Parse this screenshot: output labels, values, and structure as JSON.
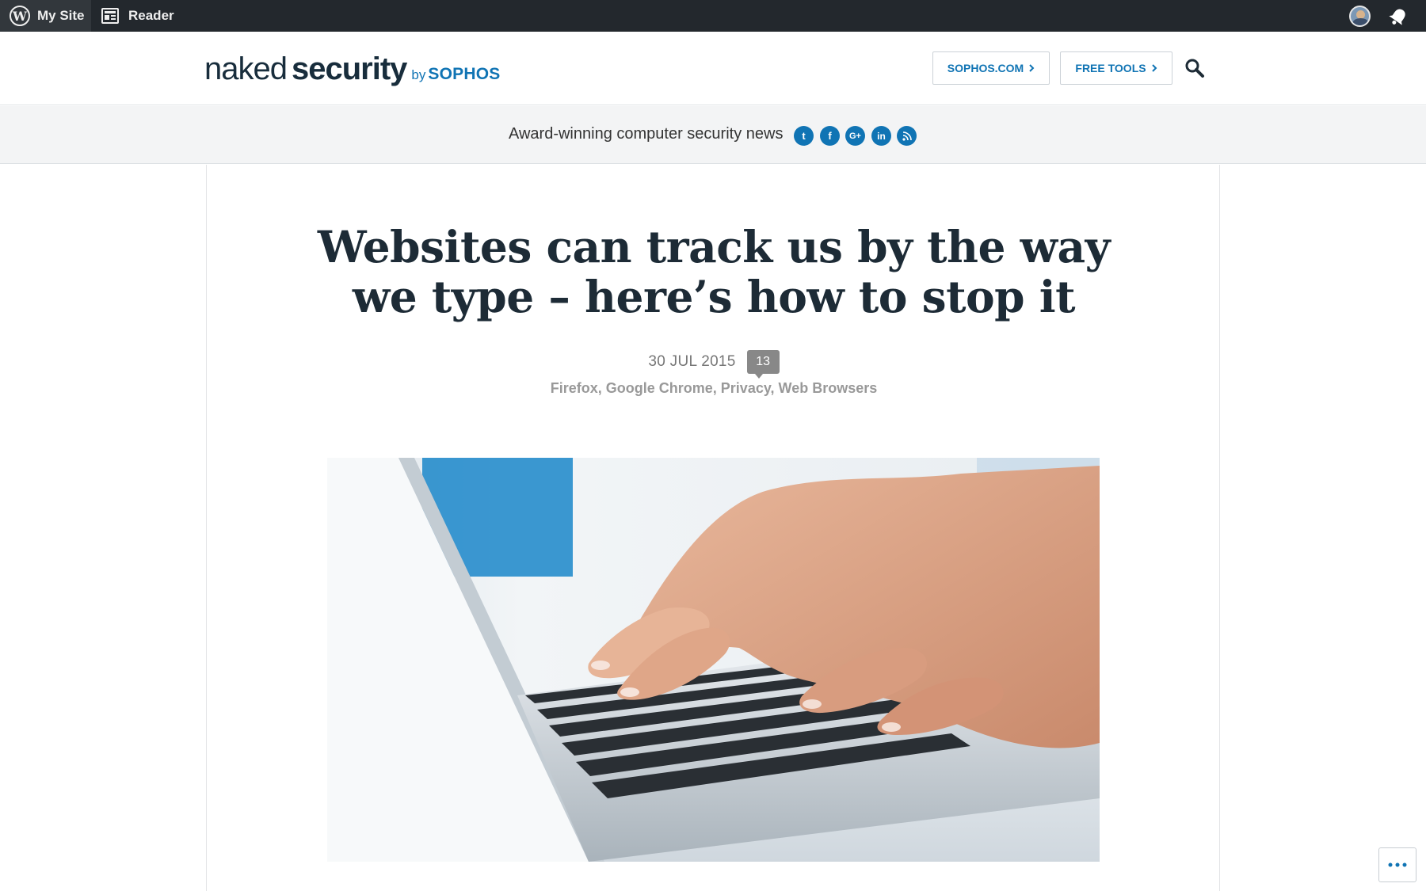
{
  "adminbar": {
    "my_site_label": "My Site",
    "reader_label": "Reader",
    "icons": [
      "wordpress-logo",
      "reader-icon",
      "avatar",
      "notifications-bell"
    ]
  },
  "header": {
    "logo": {
      "naked": "naked",
      "security": "security",
      "by": "by",
      "sophos": "SOPHOS"
    },
    "buttons": {
      "sophos_com": "SOPHOS.COM",
      "free_tools": "FREE TOOLS"
    },
    "search_icon": "search-icon"
  },
  "tagbar": {
    "tagline": "Award-winning computer security news",
    "social": [
      "twitter",
      "facebook",
      "google-plus",
      "linkedin",
      "rss"
    ],
    "social_glyphs": [
      "t",
      "f",
      "G+",
      "in",
      ")"
    ]
  },
  "article": {
    "title": "Websites can track us by the way we type – here’s how to stop it",
    "date": "30 JUL 2015",
    "comment_count": "13",
    "categories": [
      "Firefox",
      "Google Chrome",
      "Privacy",
      "Web Browsers"
    ]
  },
  "colors": {
    "adminbar_bg": "#23282d",
    "brand_blue": "#1074b4",
    "title_text": "#1d2b36",
    "tagbar_bg": "#f3f4f5"
  }
}
